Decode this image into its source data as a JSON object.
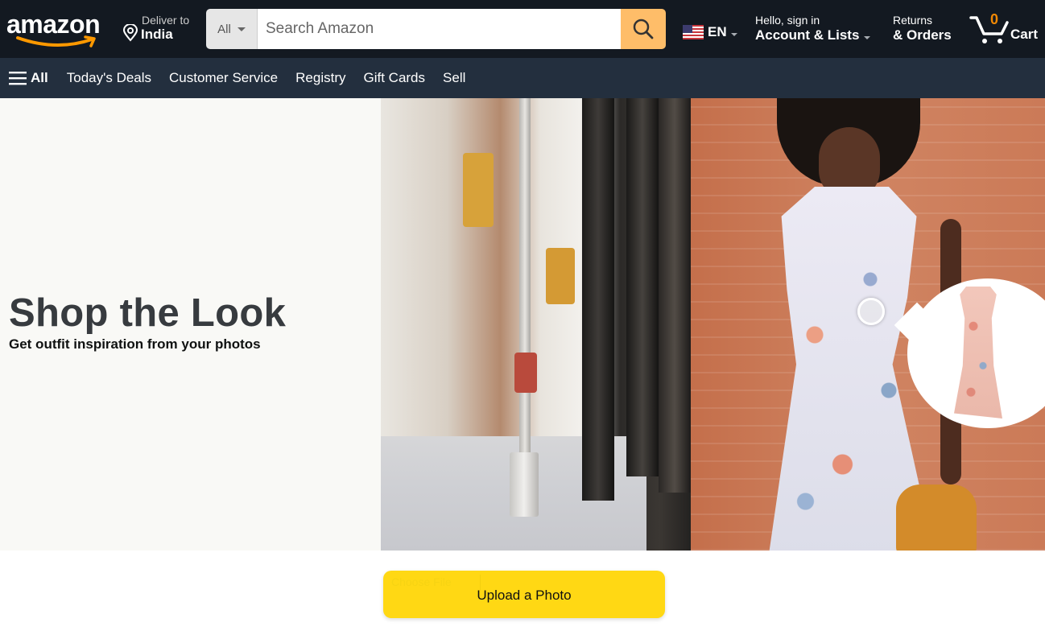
{
  "header": {
    "logo_text": "amazon",
    "deliver": {
      "line1": "Deliver to",
      "line2": "India"
    },
    "search": {
      "category": "All",
      "placeholder": "Search Amazon",
      "value": ""
    },
    "language": {
      "code": "EN",
      "flag": "us-flag-icon"
    },
    "account": {
      "line1": "Hello, sign in",
      "line2": "Account & Lists"
    },
    "returns": {
      "line1": "Returns",
      "line2": "& Orders"
    },
    "cart": {
      "count": "0",
      "label": "Cart"
    }
  },
  "subnav": {
    "all_label": "All",
    "items": [
      {
        "label": "Today's Deals"
      },
      {
        "label": "Customer Service"
      },
      {
        "label": "Registry"
      },
      {
        "label": "Gift Cards"
      },
      {
        "label": "Sell"
      }
    ]
  },
  "hero": {
    "title": "Shop the Look",
    "subtitle": "Get outfit inspiration from your photos"
  },
  "upload": {
    "file_input_label": "Choose File",
    "label": "Upload a Photo"
  },
  "colors": {
    "nav_top": "#131921",
    "nav_sub": "#232f3e",
    "search_button": "#febd69",
    "cart_count": "#f08804",
    "upload_button": "#ffd814",
    "logo_smile": "#ff9900"
  }
}
